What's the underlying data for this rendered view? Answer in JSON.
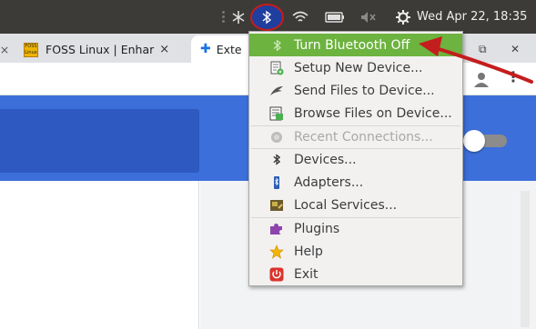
{
  "panel": {
    "clock": "Wed Apr 22, 18:35"
  },
  "browser": {
    "tabs": [
      {
        "title": "FOSS Linux | Enhar",
        "favicon_text": "FOSS Linux",
        "close": "×"
      },
      {
        "title": "Exte"
      }
    ],
    "window_controls": [
      "⧉",
      "✕"
    ]
  },
  "menu": {
    "items": [
      {
        "label": "Turn Bluetooth Off",
        "icon": "bluetooth-icon",
        "state": "highlighted"
      },
      {
        "label": "Setup New Device...",
        "icon": "setup-device-icon"
      },
      {
        "label": "Send Files to Device...",
        "icon": "send-files-icon"
      },
      {
        "label": "Browse Files on Device...",
        "icon": "browse-files-icon"
      },
      {
        "label": "Recent Connections...",
        "icon": "recent-connections-icon",
        "state": "disabled"
      },
      {
        "label": "Devices...",
        "icon": "bluetooth-icon"
      },
      {
        "label": "Adapters...",
        "icon": "adapter-icon"
      },
      {
        "label": "Local Services...",
        "icon": "local-services-icon"
      },
      {
        "label": "Plugins",
        "icon": "plugin-icon"
      },
      {
        "label": "Help",
        "icon": "star-icon"
      },
      {
        "label": "Exit",
        "icon": "power-icon"
      }
    ]
  },
  "colors": {
    "panel_bg": "#3c3b37",
    "menu_highlight": "#6db33f",
    "page_accent": "#3c6fd9",
    "annotation_red": "#cc1a1a"
  }
}
